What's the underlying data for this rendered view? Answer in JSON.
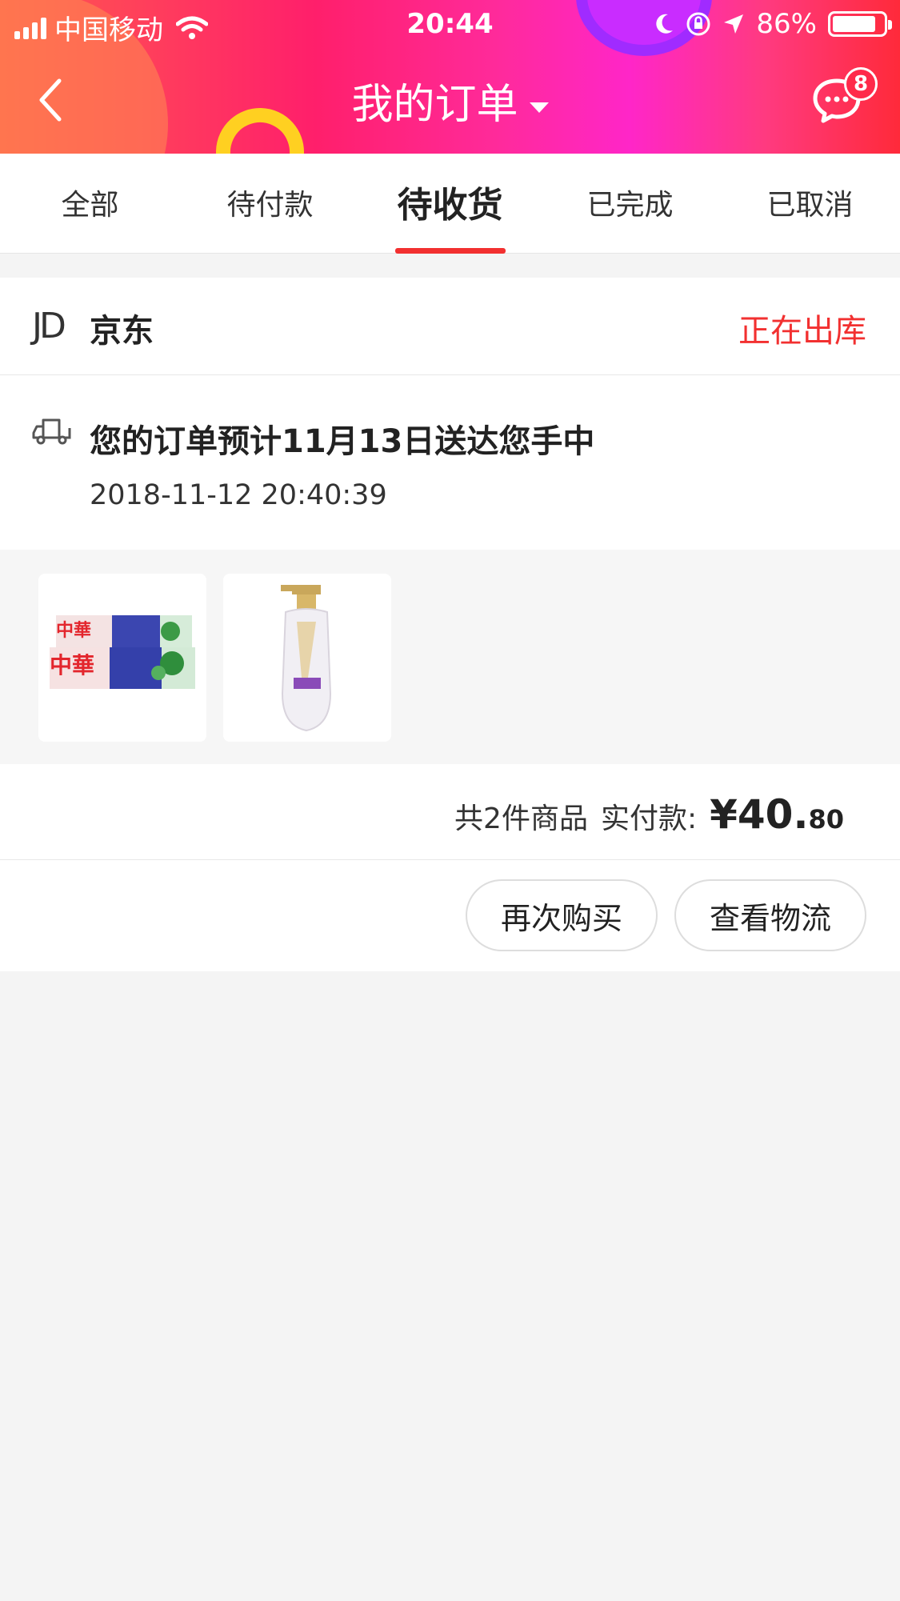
{
  "status_bar": {
    "carrier": "中国移动",
    "time": "20:44",
    "battery": "86%",
    "battery_level": 0.86
  },
  "nav": {
    "title": "我的订单",
    "message_badge": "8"
  },
  "tabs": [
    {
      "label": "全部",
      "active": false
    },
    {
      "label": "待付款",
      "active": false
    },
    {
      "label": "待收货",
      "active": true
    },
    {
      "label": "已完成",
      "active": false
    },
    {
      "label": "已取消",
      "active": false
    }
  ],
  "order": {
    "shop_logo": "JD",
    "shop_name": "京东",
    "status": "正在出库",
    "delivery_text": "您的订单预计11月13日送达您手中",
    "delivery_time": "2018-11-12 20:40:39",
    "products": [
      {
        "name": "toothpaste",
        "logo_text": "中華"
      },
      {
        "name": "shampoo-bottle"
      }
    ],
    "summary_count": "共2件商品",
    "summary_label": "实付款:",
    "price_symbol": "¥",
    "price_int": "40.",
    "price_dec": "80",
    "buttons": {
      "rebuy": "再次购买",
      "logistics": "查看物流"
    }
  },
  "colors": {
    "accent": "#f23030",
    "header_gradient": [
      "#ff5a4e",
      "#ff1f6b",
      "#ff26c8",
      "#ff2a3a"
    ]
  }
}
